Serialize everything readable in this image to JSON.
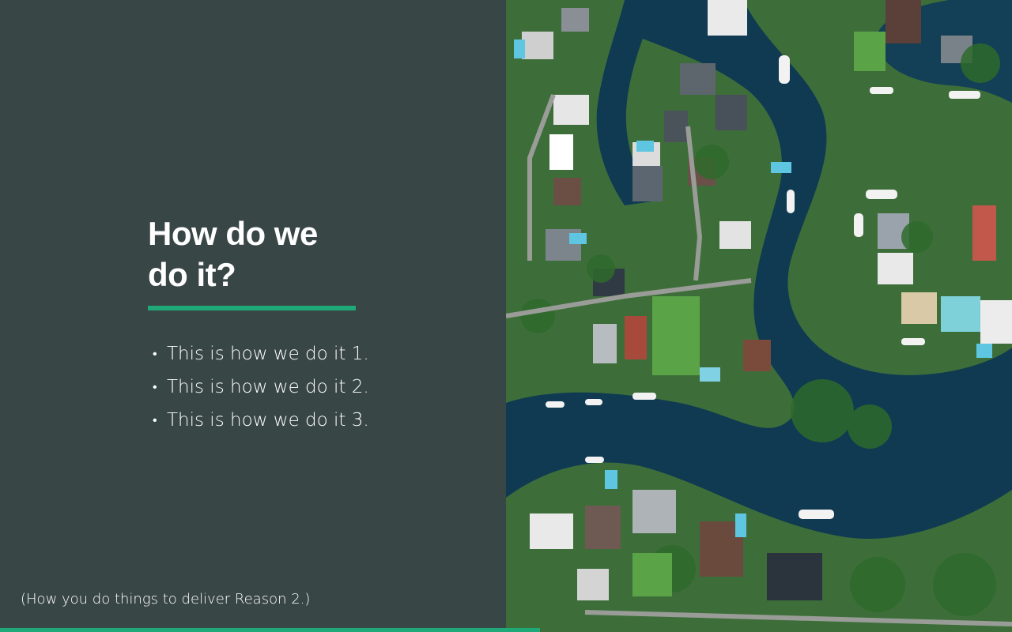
{
  "slide": {
    "title_line1": "How do we",
    "title_line2": "do it?",
    "bullets": [
      "This is how we do it 1.",
      "This is how we do it 2.",
      "This is how we do it 3."
    ],
    "bullet_glyph": "•",
    "footnote": "(How you do things to deliver Reason 2.)"
  },
  "colors": {
    "panel_bg": "#394646",
    "accent": "#1fa878",
    "text": "#ffffff",
    "water": "#0f3a52",
    "land": "#3f7a3a"
  },
  "image": {
    "subject": "aerial-view-waterfront-neighborhood-canals"
  }
}
